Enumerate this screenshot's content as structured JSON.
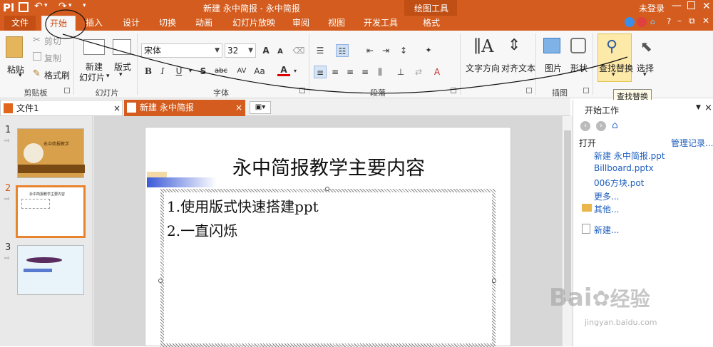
{
  "app": {
    "title": "新建 永中简报 - 永中简报",
    "tool_context": "绘图工具",
    "user": "未登录"
  },
  "tabs": [
    "文件",
    "开始",
    "插入",
    "设计",
    "切换",
    "动画",
    "幻灯片放映",
    "审阅",
    "视图",
    "开发工具",
    "格式"
  ],
  "ribbon": {
    "clipboard": {
      "paste": "粘贴",
      "cut": "剪切",
      "copy": "复制",
      "format_painter": "格式刷",
      "group": "剪贴板"
    },
    "slides": {
      "new_slide": "新建",
      "new_slide2": "幻灯片",
      "layout": "版式",
      "group": "幻灯片"
    },
    "font": {
      "name": "宋体",
      "size": "32",
      "bold": "B",
      "italic": "I",
      "underline": "U",
      "shadow": "S",
      "strike": "abc",
      "spacing": "AV",
      "case": "Aa",
      "color": "A",
      "grow": "A",
      "shrink": "A",
      "group": "字体"
    },
    "paragraph": {
      "group": "段落"
    },
    "drawing": {
      "text_dir": "文字方向",
      "align_text": "对齐文本",
      "picture": "图片",
      "shape": "形状",
      "group": "插图"
    },
    "edit": {
      "find_replace": "查找替换",
      "select": "选择",
      "tooltip": "查找替换"
    }
  },
  "doc_tabs": [
    {
      "label": "文件1"
    },
    {
      "label": "新建 永中简报"
    }
  ],
  "slides": [
    {
      "num": "1",
      "title": "永中简报教学"
    },
    {
      "num": "2",
      "title": "永中简报教学主要内容"
    },
    {
      "num": "3",
      "title": ""
    }
  ],
  "slide": {
    "title": "永中简报教学主要内容",
    "items": [
      "1.使用版式快速搭建ppt",
      "2.一直闪烁"
    ]
  },
  "task_pane": {
    "title": "开始工作",
    "open_label": "打开",
    "manage": "管理记录...",
    "files": [
      "新建 永中简报.ppt",
      "Billboard.pptx",
      "006方块.pot",
      "更多..."
    ],
    "other": "其他...",
    "new": "新建..."
  },
  "watermark": {
    "brand": "Bai",
    "brand2": "经验",
    "url": "jingyan.baidu.com"
  }
}
